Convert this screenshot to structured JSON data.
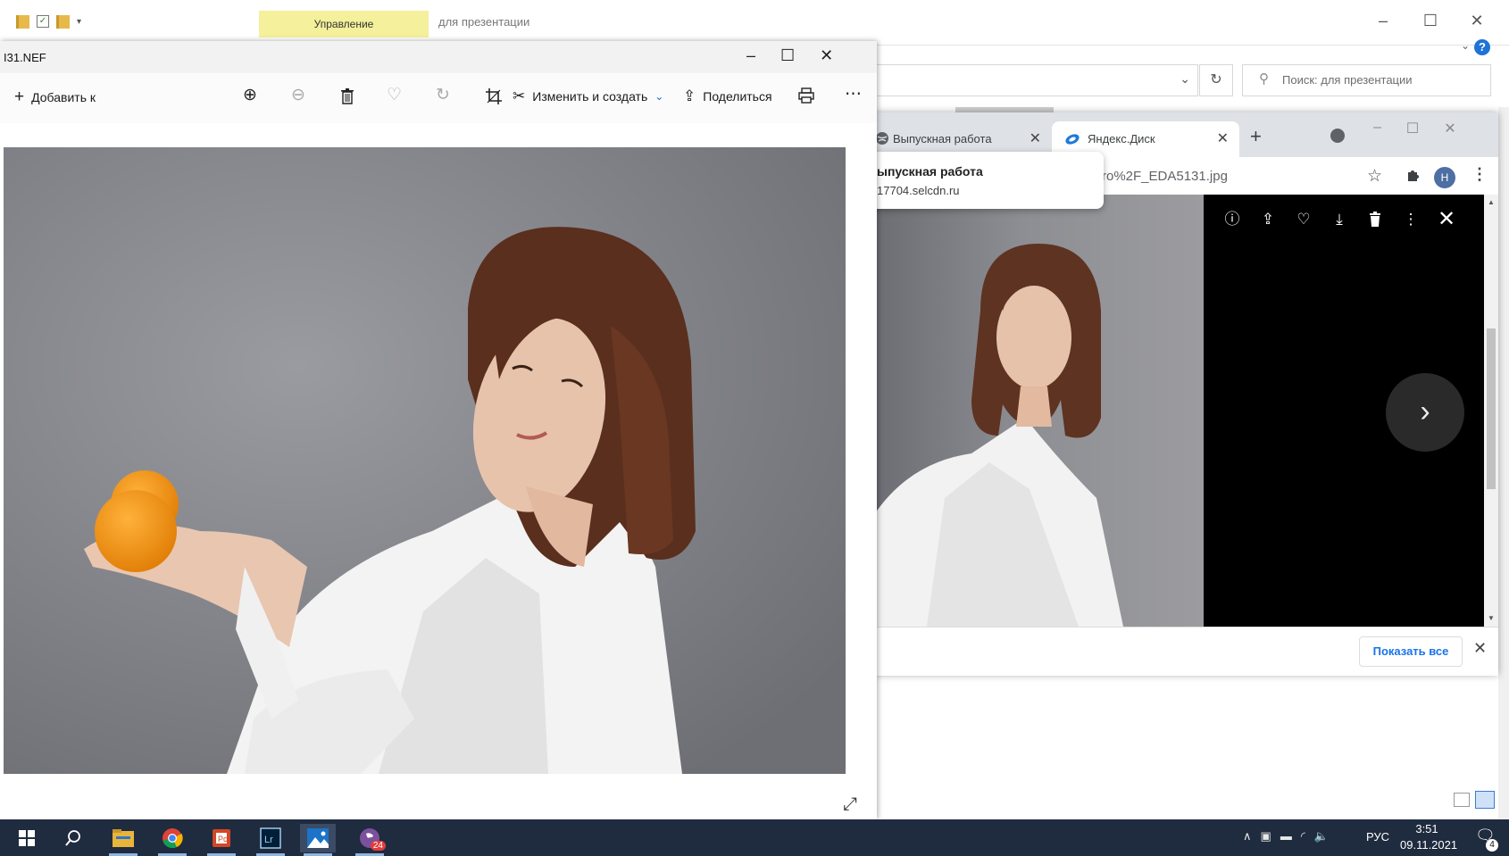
{
  "explorer": {
    "ribbon_tab": "Управление",
    "window_title": "для презентации",
    "search_placeholder": "Поиск: для презентации",
    "help_label": "?"
  },
  "photos_app": {
    "file_name": "I31.NEF",
    "toolbar": {
      "add_label": "Добавить к",
      "edit_label": "Изменить и создать",
      "share_label": "Поделиться"
    }
  },
  "browser": {
    "tabs": [
      {
        "label": "Выпускная работа"
      },
      {
        "label": "Яндекс.Диск"
      }
    ],
    "url_fragment": "ro%2F_EDA5131.jpg",
    "profile_initial": "Н",
    "tooltip": {
      "title": "ыпускная работа",
      "url": "17704.selcdn.ru"
    },
    "download_bar": {
      "show_all_label": "Показать все"
    }
  },
  "taskbar": {
    "language": "РУС",
    "time": "3:51",
    "date": "09.11.2021",
    "viber_badge": "24",
    "notification_count": "4",
    "icons": [
      "windows-start-icon",
      "search-icon",
      "file-explorer-icon",
      "chrome-icon",
      "powerpoint-icon",
      "lightroom-icon",
      "photos-icon",
      "viber-icon"
    ]
  }
}
